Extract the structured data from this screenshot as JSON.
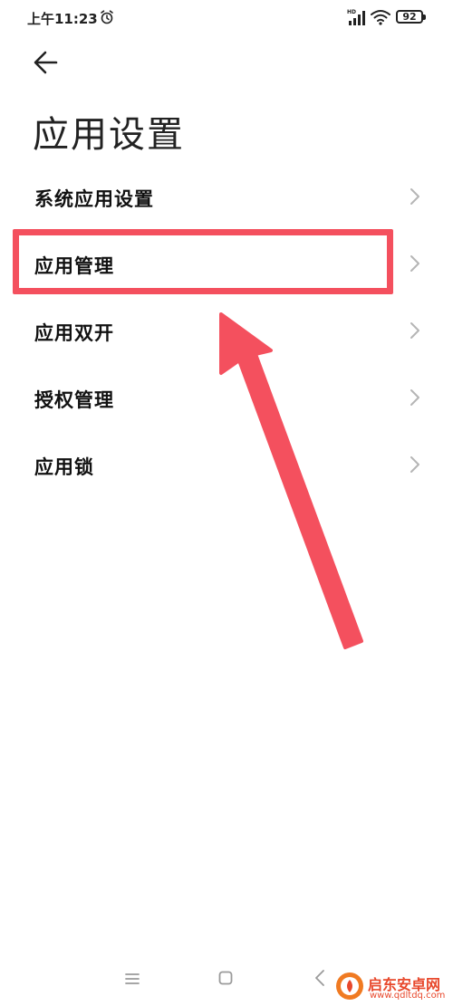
{
  "status_bar": {
    "time": "上午11:23",
    "battery": "92"
  },
  "header": {
    "title": "应用设置"
  },
  "settings": {
    "items": [
      {
        "label": "系统应用设置"
      },
      {
        "label": "应用管理"
      },
      {
        "label": "应用双开"
      },
      {
        "label": "授权管理"
      },
      {
        "label": "应用锁"
      }
    ]
  },
  "watermark": {
    "name": "启东安卓网",
    "url": "www.qdltdq.com"
  },
  "colors": {
    "annotation": "#f4505e",
    "watermark": "#e8482c"
  },
  "icons": {
    "back": "arrow-left-icon",
    "chevron": "chevron-right-icon",
    "nav_menu": "menu-icon",
    "nav_home": "home-square-icon",
    "nav_back": "chevron-left-icon"
  }
}
